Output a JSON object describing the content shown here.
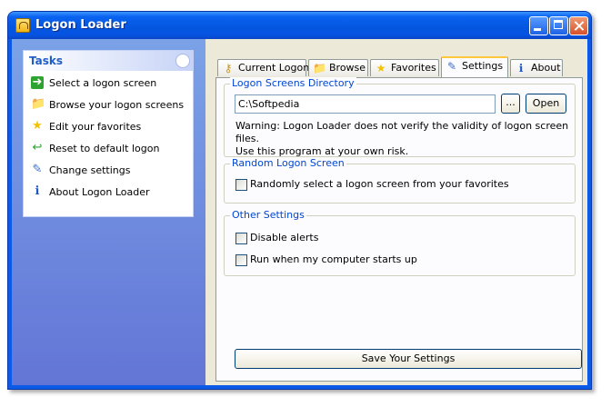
{
  "window": {
    "title": "Logon Loader"
  },
  "tasks": {
    "title": "Tasks",
    "items": [
      {
        "label": "Select a logon screen",
        "icon": "green-arrow-icon"
      },
      {
        "label": "Browse your logon screens",
        "icon": "folder-icon"
      },
      {
        "label": "Edit your favorites",
        "icon": "star-icon"
      },
      {
        "label": "Reset to default logon",
        "icon": "green-back-arrow-icon"
      },
      {
        "label": "Change settings",
        "icon": "settings-icon"
      },
      {
        "label": "About Logon Loader",
        "icon": "info-icon"
      }
    ]
  },
  "tabs": [
    {
      "label": "Current Logon",
      "icon": "key-icon"
    },
    {
      "label": "Browse",
      "icon": "folder-icon"
    },
    {
      "label": "Favorites",
      "icon": "star-icon"
    },
    {
      "label": "Settings",
      "icon": "settings-icon",
      "active": true
    },
    {
      "label": "About",
      "icon": "info-icon"
    }
  ],
  "settings": {
    "directory_group": "Logon Screens Directory",
    "directory_value": "C:\\Softpedia",
    "browse_button": "...",
    "open_button": "Open",
    "warning_line1": "Warning: Logon Loader does not verify the validity of logon screen files.",
    "warning_line2": "Use this program at your own risk.",
    "random_group": "Random Logon Screen",
    "random_checkbox": "Randomly select a logon screen from your favorites",
    "other_group": "Other Settings",
    "disable_alerts": "Disable alerts",
    "run_startup": "Run when my computer starts up",
    "save_button": "Save Your Settings"
  },
  "colors": {
    "title_bar": "#0457e0",
    "group_label": "#0046d5",
    "task_pane": "#7ba2e7"
  }
}
